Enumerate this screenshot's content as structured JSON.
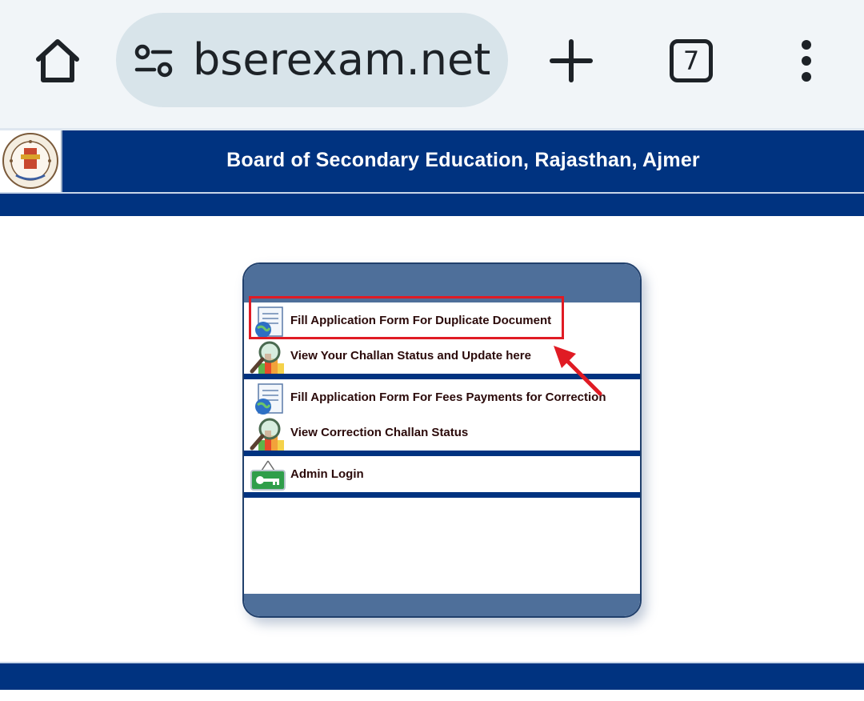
{
  "browser": {
    "url": "bserexam.net/b",
    "tab_count": "7",
    "icons": [
      "home-icon",
      "tune-icon",
      "plus-icon",
      "tab-switcher-icon",
      "more-vert-icon"
    ]
  },
  "header": {
    "title": "Board of Secondary Education, Rajasthan, Ajmer",
    "bg_color": "#003380"
  },
  "menu": {
    "items": [
      {
        "label": "Fill Application Form For Duplicate Document",
        "icon": "document-globe-icon"
      },
      {
        "label": "View Your Challan Status and Update here",
        "icon": "magnifier-chart-icon"
      },
      {
        "label": "Fill Application Form For Fees Payments for Correction",
        "icon": "document-globe-icon"
      },
      {
        "label": "View Correction Challan Status",
        "icon": "magnifier-chart-icon"
      },
      {
        "label": "Admin Login",
        "icon": "key-sign-icon"
      }
    ]
  },
  "annotation": {
    "highlight_color": "#e01b24",
    "highlighted_item": "Fill Application Form For Duplicate Document"
  }
}
